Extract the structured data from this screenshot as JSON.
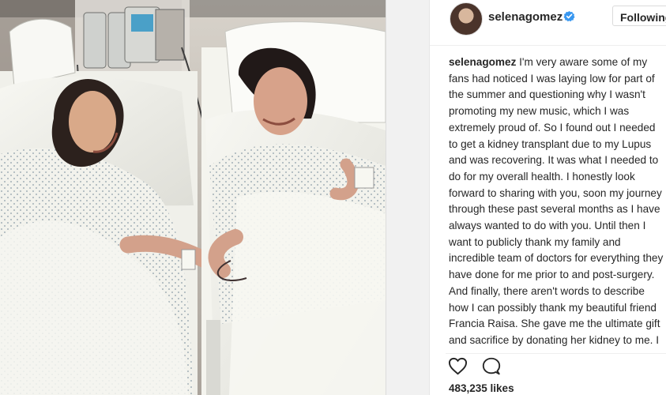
{
  "post": {
    "username": "selenagomez",
    "follow_label": "Following",
    "caption_username": "selenagomez",
    "caption_text": "I'm very aware some of my fans had noticed I was laying low for part of the summer and questioning why I wasn't promoting my new music, which I was extremely proud of. So I found out I needed to get a kidney transplant due to my Lupus and was recovering. It was what I needed to do for my overall health. I honestly look forward to sharing with you, soon my journey through these past several months as I have always wanted to do with you. Until then I want to publicly thank my family and incredible team of doctors for everything they have done for me prior to and post-surgery. And finally, there aren't words to describe how I can possibly thank my beautiful friend Francia Raisa. She gave me the ultimate gift and sacrifice by donating her kidney to me. I am incredibly blessed. I love you so much sis.",
    "likes": "483,235 likes"
  },
  "icons": {
    "verified": "verified-badge-icon",
    "heart": "heart-icon",
    "comment": "comment-icon"
  },
  "colors": {
    "text": "#262626",
    "verified": "#3897f0",
    "border": "#dbdbdb"
  }
}
